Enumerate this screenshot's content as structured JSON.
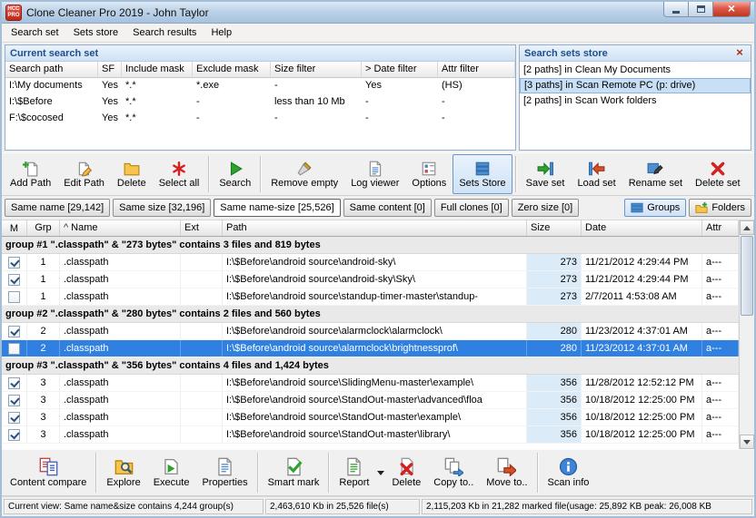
{
  "window": {
    "title": "Clone Cleaner Pro 2019 - John Taylor",
    "logo": {
      "line1": "HCC",
      "line2": "PRO"
    }
  },
  "menu": {
    "items": [
      "Search set",
      "Sets store",
      "Search results",
      "Help"
    ]
  },
  "current_search_set": {
    "title": "Current search set",
    "columns": [
      "Search path",
      "SF",
      "Include mask",
      "Exclude mask",
      "Size filter",
      "> Date filter",
      "Attr filter"
    ],
    "rows": [
      [
        "I:\\My documents",
        "Yes",
        "*.*",
        "*.exe",
        "-",
        "Yes",
        "(HS)"
      ],
      [
        "I:\\$Before",
        "Yes",
        "*.*",
        "-",
        "less than 10 Mb",
        "-",
        "-"
      ],
      [
        "F:\\$cocosed",
        "Yes",
        "*.*",
        "-",
        "-",
        "-",
        "-"
      ]
    ]
  },
  "sets_store": {
    "title": "Search sets store",
    "items": [
      {
        "label": "[2 paths] in Clean My Documents",
        "selected": false
      },
      {
        "label": "[3 paths] in Scan Remote PC (p: drive)",
        "selected": true
      },
      {
        "label": "[2 paths] in Scan Work folders",
        "selected": false
      }
    ]
  },
  "main_toolbar": {
    "buttons": [
      {
        "label": "Add Path"
      },
      {
        "label": "Edit Path"
      },
      {
        "label": "Delete"
      },
      {
        "label": "Select all"
      },
      {
        "label": "Search"
      },
      {
        "label": "Remove empty"
      },
      {
        "label": "Log viewer"
      },
      {
        "label": "Options"
      },
      {
        "label": "Sets Store",
        "pressed": true
      },
      {
        "label": "Save set"
      },
      {
        "label": "Load set"
      },
      {
        "label": "Rename set"
      },
      {
        "label": "Delete set"
      }
    ]
  },
  "filter_bar": {
    "tabs": [
      {
        "label": "Same name [29,142]",
        "active": false
      },
      {
        "label": "Same size [32,196]",
        "active": false
      },
      {
        "label": "Same name-size [25,526]",
        "active": true
      },
      {
        "label": "Same content [0]",
        "active": false
      },
      {
        "label": "Full clones [0]",
        "active": false
      },
      {
        "label": "Zero size [0]",
        "active": false
      }
    ],
    "view_buttons": [
      {
        "label": "Groups",
        "pressed": true
      },
      {
        "label": "Folders",
        "pressed": false
      }
    ]
  },
  "results": {
    "header": {
      "m": "M",
      "grp": "Grp",
      "sort_glyph": "^",
      "name": "Name",
      "ext": "Ext",
      "path": "Path",
      "size": "Size",
      "date": "Date",
      "attr": "Attr"
    },
    "rows": [
      {
        "type": "group",
        "label": "group #1 \".classpath\" & \"273 bytes\" contains 3 files and 819 bytes"
      },
      {
        "type": "file",
        "checked": true,
        "selected": false,
        "grp": "1",
        "name": ".classpath",
        "ext": "",
        "path": "I:\\$Before\\android source\\android-sky\\",
        "size": "273",
        "date": "11/21/2012 4:29:44 PM",
        "attr": "a---"
      },
      {
        "type": "file",
        "checked": true,
        "selected": false,
        "grp": "1",
        "name": ".classpath",
        "ext": "",
        "path": "I:\\$Before\\android source\\android-sky\\Sky\\",
        "size": "273",
        "date": "11/21/2012 4:29:44 PM",
        "attr": "a---"
      },
      {
        "type": "file",
        "checked": false,
        "selected": false,
        "grp": "1",
        "name": ".classpath",
        "ext": "",
        "path": "I:\\$Before\\android source\\standup-timer-master\\standup-",
        "size": "273",
        "date": "2/7/2011 4:53:08 AM",
        "attr": "a---"
      },
      {
        "type": "group",
        "label": "group #2 \".classpath\" & \"280 bytes\" contains 2 files and 560 bytes"
      },
      {
        "type": "file",
        "checked": true,
        "selected": false,
        "grp": "2",
        "name": ".classpath",
        "ext": "",
        "path": "I:\\$Before\\android source\\alarmclock\\alarmclock\\",
        "size": "280",
        "date": "11/23/2012 4:37:01 AM",
        "attr": "a---"
      },
      {
        "type": "file",
        "checked": false,
        "selected": true,
        "grp": "2",
        "name": ".classpath",
        "ext": "",
        "path": "I:\\$Before\\android source\\alarmclock\\brightnessprof\\",
        "size": "280",
        "date": "11/23/2012 4:37:01 AM",
        "attr": "a---"
      },
      {
        "type": "group",
        "label": "group #3 \".classpath\" & \"356 bytes\" contains 4 files and 1,424 bytes"
      },
      {
        "type": "file",
        "checked": true,
        "selected": false,
        "grp": "3",
        "name": ".classpath",
        "ext": "",
        "path": "I:\\$Before\\android source\\SlidingMenu-master\\example\\",
        "size": "356",
        "date": "11/28/2012 12:52:12 PM",
        "attr": "a---"
      },
      {
        "type": "file",
        "checked": true,
        "selected": false,
        "grp": "3",
        "name": ".classpath",
        "ext": "",
        "path": "I:\\$Before\\android source\\StandOut-master\\advanced\\floa",
        "size": "356",
        "date": "10/18/2012 12:25:00 PM",
        "attr": "a---"
      },
      {
        "type": "file",
        "checked": true,
        "selected": false,
        "grp": "3",
        "name": ".classpath",
        "ext": "",
        "path": "I:\\$Before\\android source\\StandOut-master\\example\\",
        "size": "356",
        "date": "10/18/2012 12:25:00 PM",
        "attr": "a---"
      },
      {
        "type": "file",
        "checked": true,
        "selected": false,
        "grp": "3",
        "name": ".classpath",
        "ext": "",
        "path": "I:\\$Before\\android source\\StandOut-master\\library\\",
        "size": "356",
        "date": "10/18/2012 12:25:00 PM",
        "attr": "a---"
      }
    ]
  },
  "bottom_toolbar": {
    "buttons": [
      {
        "label": "Content compare"
      },
      {
        "label": "Explore"
      },
      {
        "label": "Execute"
      },
      {
        "label": "Properties"
      },
      {
        "label": "Smart mark"
      },
      {
        "label": "Report"
      },
      {
        "label": "Delete"
      },
      {
        "label": "Copy to.."
      },
      {
        "label": "Move to.."
      },
      {
        "label": "Scan info"
      }
    ]
  },
  "status_bar": {
    "segments": [
      "Current view: Same name&size contains 4,244 group(s)",
      "2,463,610 Kb in 25,526 file(s)",
      "2,115,203 Kb in 21,282 marked file(usage: 25,892 KB peak: 26,008 KB"
    ]
  },
  "colors": {
    "selection_blue": "#2f80e0",
    "size_column_bg": "#dcebf8",
    "panel_header_text": "#1e4e8c",
    "close_button_red": "#bd3722"
  }
}
